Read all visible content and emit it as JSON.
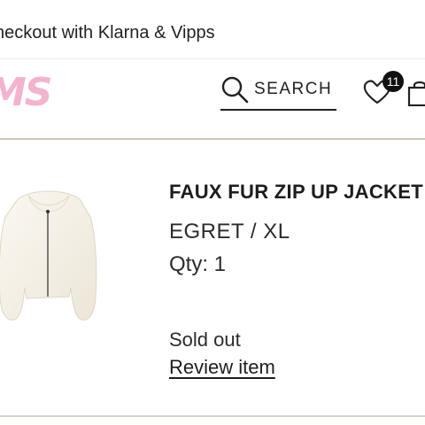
{
  "promo": {
    "text": "heckout with Klarna & Vipps"
  },
  "header": {
    "logo_text": "MS",
    "search_label": "SEARCH",
    "wishlist_count": "11",
    "icons": [
      "search-icon",
      "heart-icon",
      "bag-icon"
    ]
  },
  "product": {
    "title": "FAUX FUR ZIP UP JACKET",
    "variant": "EGRET / XL",
    "quantity": "Qty: 1",
    "status": "Sold out",
    "review_link": "Review item",
    "image_icon": "white-faux-fur-jacket"
  },
  "colors": {
    "logo": "#f3b3cf",
    "text": "#1d1d1d",
    "divider": "#cfc6b8",
    "badge": "#111111"
  }
}
